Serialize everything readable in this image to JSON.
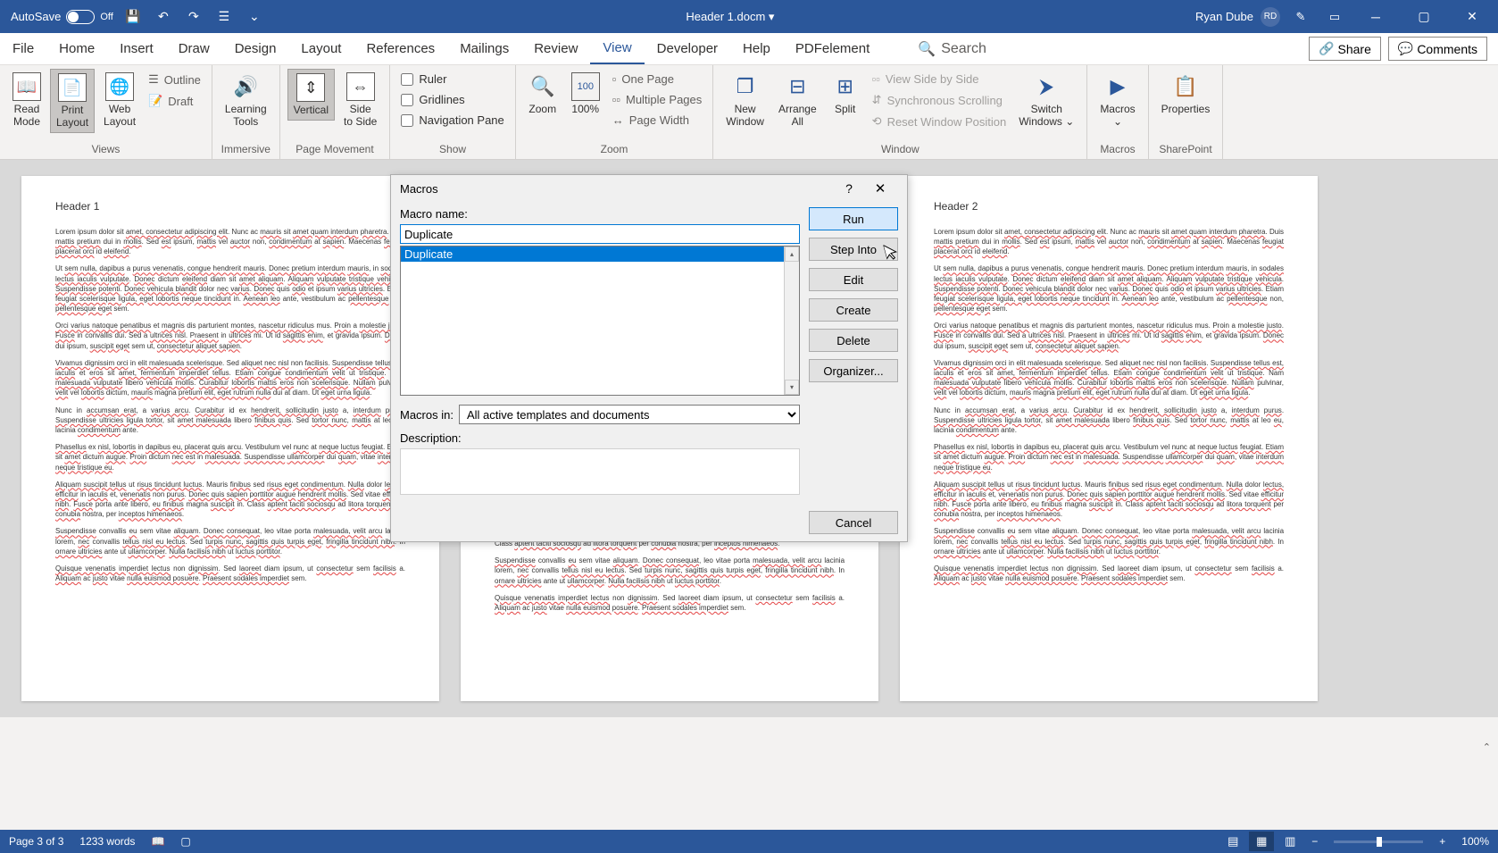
{
  "titlebar": {
    "autosave": "AutoSave",
    "autosave_state": "Off",
    "doc_title": "Header 1.docm ▾",
    "user": "Ryan Dube",
    "user_initials": "RD"
  },
  "tabs": [
    "File",
    "Home",
    "Insert",
    "Draw",
    "Design",
    "Layout",
    "References",
    "Mailings",
    "Review",
    "View",
    "Developer",
    "Help",
    "PDFelement"
  ],
  "active_tab": "View",
  "search_placeholder": "Search",
  "share": "Share",
  "comments": "Comments",
  "ribbon": {
    "views": {
      "label": "Views",
      "read_mode": "Read\nMode",
      "print_layout": "Print\nLayout",
      "web_layout": "Web\nLayout",
      "outline": "Outline",
      "draft": "Draft"
    },
    "immersive": {
      "label": "Immersive",
      "learning_tools": "Learning\nTools"
    },
    "page_movement": {
      "label": "Page Movement",
      "vertical": "Vertical",
      "side": "Side\nto Side"
    },
    "show": {
      "label": "Show",
      "ruler": "Ruler",
      "gridlines": "Gridlines",
      "nav": "Navigation Pane"
    },
    "zoom": {
      "label": "Zoom",
      "zoom": "Zoom",
      "hundred": "100%",
      "one_page": "One Page",
      "multi": "Multiple Pages",
      "width": "Page Width"
    },
    "window": {
      "label": "Window",
      "new": "New\nWindow",
      "arrange": "Arrange\nAll",
      "split": "Split",
      "side_by_side": "View Side by Side",
      "sync_scroll": "Synchronous Scrolling",
      "reset_pos": "Reset Window Position",
      "switch": "Switch\nWindows ⌄"
    },
    "macros": {
      "label": "Macros",
      "macros": "Macros\n⌄"
    },
    "sharepoint": {
      "label": "SharePoint",
      "properties": "Properties"
    }
  },
  "dialog": {
    "title": "Macros",
    "macro_name_label": "Macro name:",
    "macro_name": "Duplicate",
    "list": [
      "Duplicate"
    ],
    "macros_in_label": "Macros in:",
    "macros_in": "All active templates and documents",
    "description_label": "Description:",
    "run": "Run",
    "step_into": "Step Into",
    "edit": "Edit",
    "create": "Create",
    "delete": "Delete",
    "organizer": "Organizer...",
    "cancel": "Cancel"
  },
  "doc": {
    "h1": "Header 1",
    "h2": "Header 2"
  },
  "statusbar": {
    "page": "Page 3 of 3",
    "words": "1233 words",
    "zoom": "100%"
  }
}
